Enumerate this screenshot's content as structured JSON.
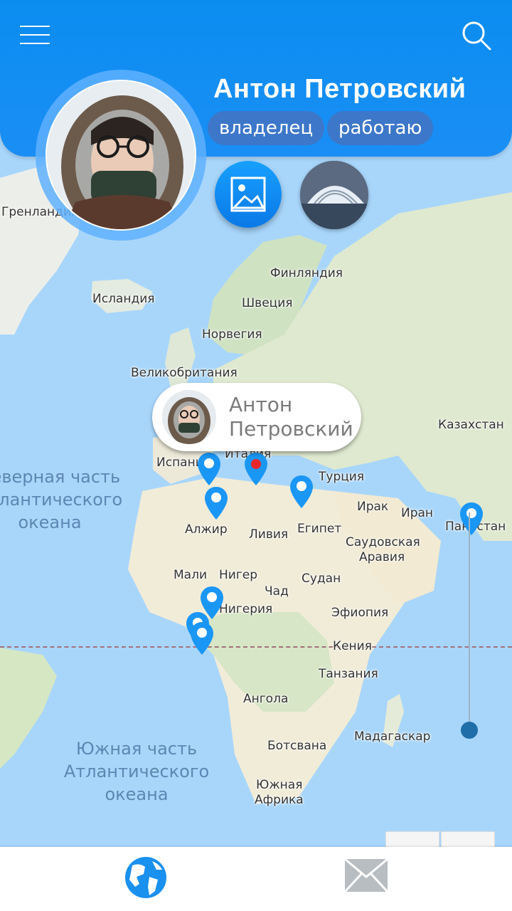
{
  "header": {
    "user_name": "Антон Петровский",
    "chips": [
      "владелец",
      "работаю"
    ]
  },
  "bubble": {
    "name_line1": "Антон",
    "name_line2": "Петровский"
  },
  "map": {
    "places": {
      "greenland": "Гренландия",
      "iceland": "Исландия",
      "finland": "Финляндия",
      "sweden": "Швеция",
      "norway": "Норвегия",
      "uk": "Великобритания",
      "kazakhstan": "Казахстан",
      "spain": "Испания",
      "italy": "Италия",
      "turkey": "Турция",
      "iraq": "Ирак",
      "iran": "Иран",
      "pakistan": "Пакистан",
      "algeria": "Алжир",
      "libya": "Ливия",
      "egypt": "Египет",
      "saudi_line1": "Саудовская",
      "saudi_line2": "Аравия",
      "mali": "Мали",
      "niger": "Нигер",
      "sudan": "Судан",
      "chad": "Чад",
      "nigeria": "Нигерия",
      "ethiopia": "Эфиопия",
      "kenya": "Кения",
      "tanzania": "Танзания",
      "angola": "Ангола",
      "madagascar": "Мадагаскар",
      "botswana": "Ботсвана",
      "south_africa_line1": "Южная",
      "south_africa_line2": "Африка"
    },
    "oceans": {
      "north_line1": "Северная часть",
      "north_line2": "Атлантического",
      "north_line3": "океана",
      "south_line1": "Южная часть",
      "south_line2": "Атлантического",
      "south_line3": "океана"
    }
  },
  "colors": {
    "header": "#0b8df0",
    "chip": "#3d77c9",
    "pin": "#1a96f5",
    "pin_active": "#e8262a"
  },
  "bottom_tabs": [
    {
      "icon": "globe-icon"
    },
    {
      "icon": "mail-icon"
    }
  ]
}
